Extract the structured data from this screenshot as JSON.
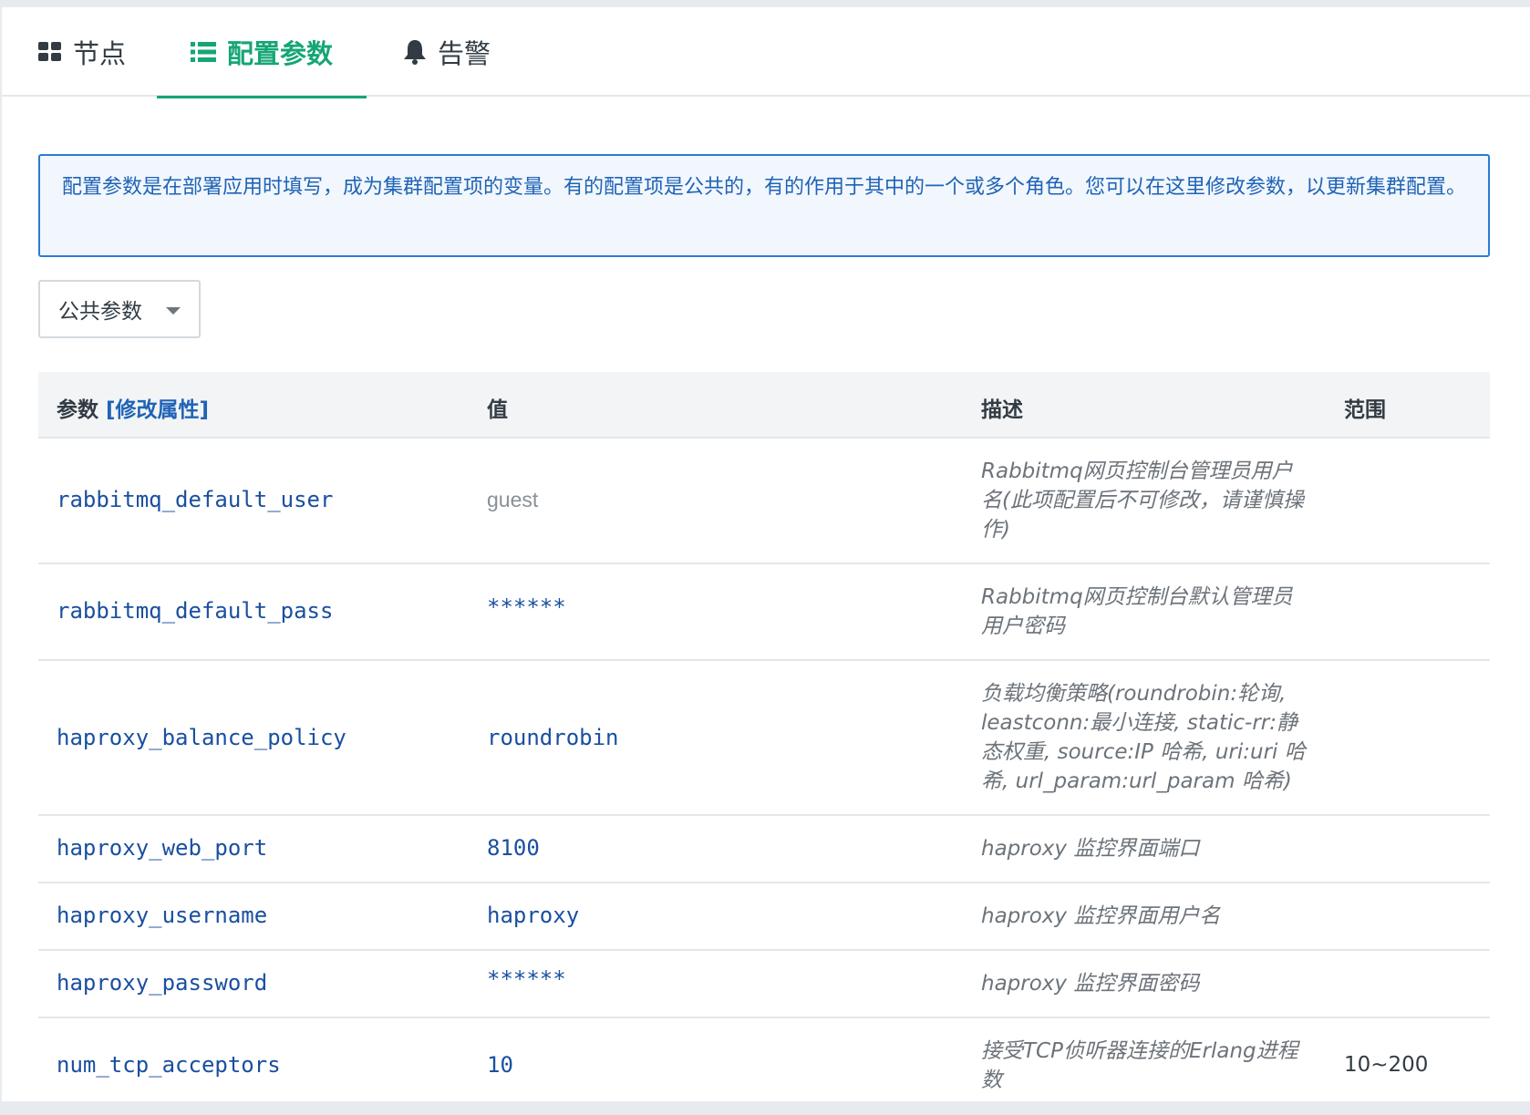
{
  "tabs": [
    {
      "label": "节点",
      "icon": "grid-icon"
    },
    {
      "label": "配置参数",
      "icon": "list-icon",
      "active": true
    },
    {
      "label": "告警",
      "icon": "bell-icon"
    }
  ],
  "colors": {
    "accent": "#15a675",
    "link": "#1a4fa0",
    "info": "#2063b6"
  },
  "info_text": "配置参数是在部署应用时填写，成为集群配置项的变量。有的配置项是公共的，有的作用于其中的一个或多个角色。您可以在这里修改参数，以更新集群配置。",
  "dropdown": {
    "value": "公共参数"
  },
  "table": {
    "headers": {
      "param": "参数",
      "modify": "[修改属性]",
      "value": "值",
      "desc": "描述",
      "range": "范围"
    },
    "rows": [
      {
        "name": "rabbitmq_default_user",
        "value": "guest",
        "desc": "Rabbitmq网页控制台管理员用户名(此项配置后不可修改，请谨慎操作)",
        "range": ""
      },
      {
        "name": "rabbitmq_default_pass",
        "value": "******",
        "desc": "Rabbitmq网页控制台默认管理员用户密码",
        "range": ""
      },
      {
        "name": "haproxy_balance_policy",
        "value": "roundrobin",
        "desc": "负载均衡策略(roundrobin:轮询, leastconn:最小连接, static-rr:静态权重, source:IP 哈希, uri:uri 哈希, url_param:url_param 哈希)",
        "range": ""
      },
      {
        "name": "haproxy_web_port",
        "value": "8100",
        "desc": "haproxy 监控界面端口",
        "range": ""
      },
      {
        "name": "haproxy_username",
        "value": "haproxy",
        "desc": "haproxy 监控界面用户名",
        "range": ""
      },
      {
        "name": "haproxy_password",
        "value": "******",
        "desc": "haproxy 监控界面密码",
        "range": ""
      },
      {
        "name": "num_tcp_acceptors",
        "value": "10",
        "desc": "接受TCP侦听器连接的Erlang进程数",
        "range": "10~200"
      }
    ]
  }
}
